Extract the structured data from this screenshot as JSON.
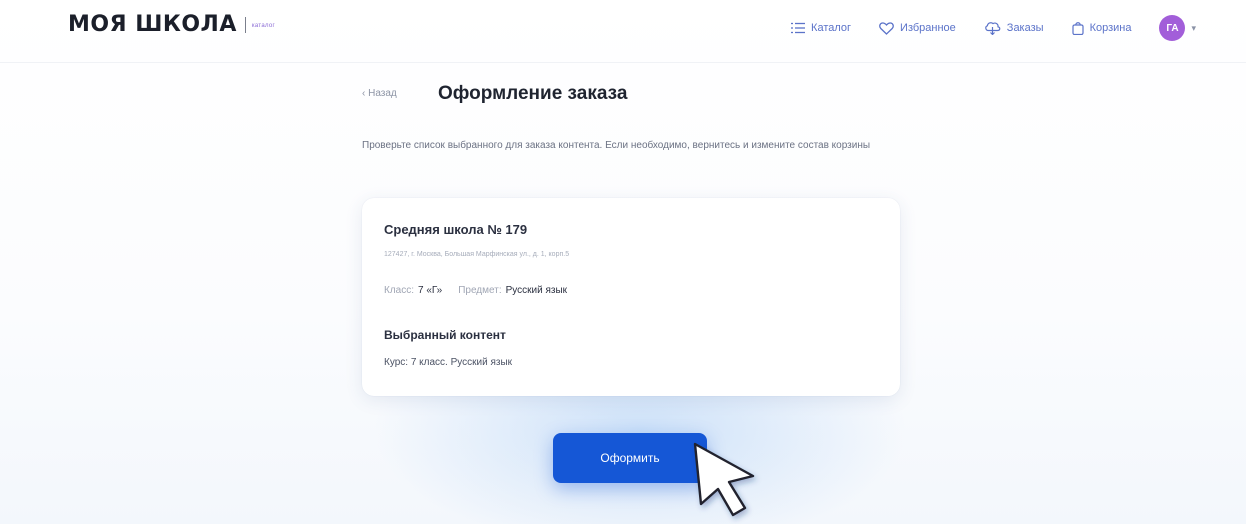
{
  "header": {
    "logo_text": "МОЯ ШКОЛА",
    "logo_tag": "каталог",
    "nav": [
      {
        "label": "Каталог",
        "icon": "list-icon"
      },
      {
        "label": "Избранное",
        "icon": "heart-icon"
      },
      {
        "label": "Заказы",
        "icon": "cloud-icon"
      },
      {
        "label": "Корзина",
        "icon": "bag-icon"
      }
    ],
    "avatar_initials": "ГА",
    "avatar_color": "#a25ed9"
  },
  "main": {
    "back_label": "‹ Назад",
    "title": "Оформление заказа",
    "description": "Проверьте список выбранного для заказа контента. Если необходимо, вернитесь и измените состав корзины"
  },
  "order_card": {
    "school_name": "Средняя школа № 179",
    "school_address": "127427, г. Москва, Большая Марфинская ул., д. 1, корп.5",
    "class_label": "Класс:",
    "class_value": "7 «Г»",
    "subject_label": "Предмет:",
    "subject_value": "Русский язык",
    "content_heading": "Выбранный контент",
    "content_value": "Курс: 7 класс. Русский язык"
  },
  "submit_label": "Оформить",
  "colors": {
    "accent": "#1557d6",
    "nav_link": "#5b73c9",
    "avatar": "#a25ed9"
  }
}
